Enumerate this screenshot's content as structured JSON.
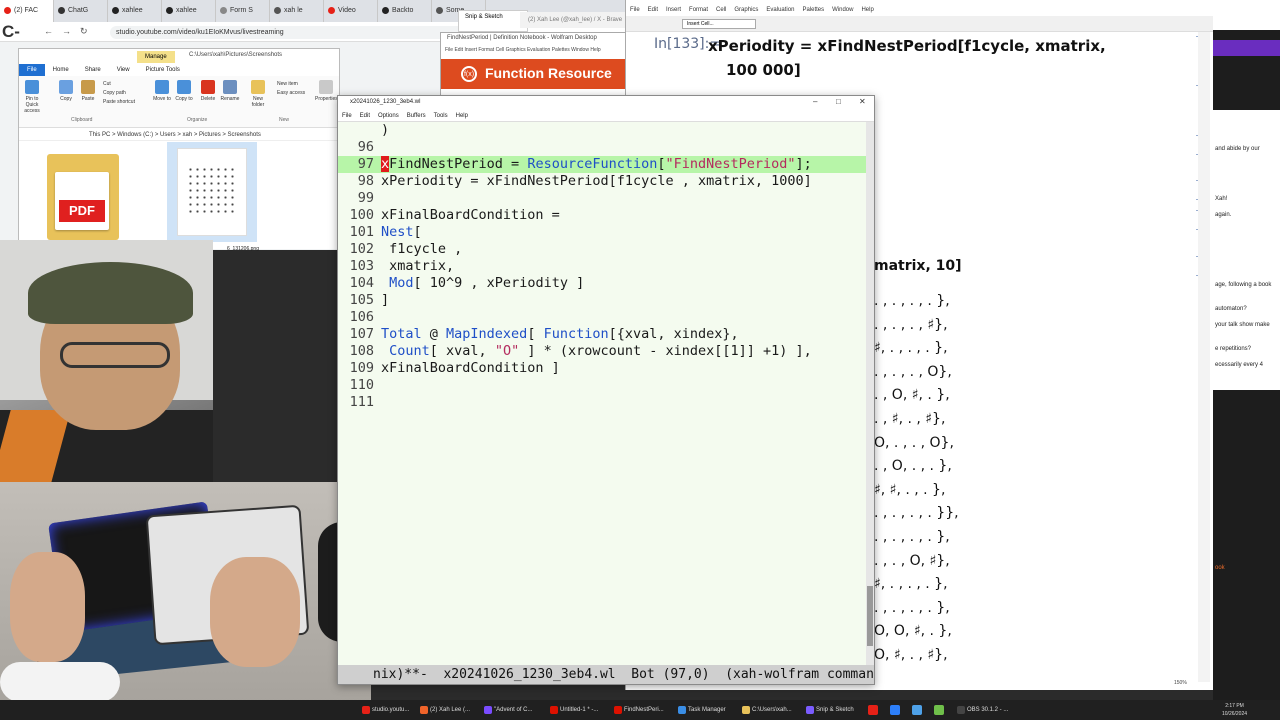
{
  "browser": {
    "tabs": [
      {
        "label": "(2) FAC",
        "color": "#e62117"
      },
      {
        "label": "ChatG",
        "color": "#333333"
      },
      {
        "label": "xahlee",
        "color": "#222222"
      },
      {
        "label": "xahlee",
        "color": "#222222"
      },
      {
        "label": "Form S",
        "color": "#888888"
      },
      {
        "label": "xah le",
        "color": "#555555"
      },
      {
        "label": "Video",
        "color": "#e62117"
      },
      {
        "label": "Backto",
        "color": "#222222"
      },
      {
        "label": "Some",
        "color": "#555555"
      }
    ],
    "url": "studio.youtube.com/video/ku1EIoKMvus/livestreaming",
    "app_label": "C-"
  },
  "explorer": {
    "manage": "Manage",
    "path": "C:\\Users\\xah\\Pictures\\Screenshots",
    "ribbon_tabs": [
      "File",
      "Home",
      "Share",
      "View",
      "Picture Tools"
    ],
    "buttons": [
      "Pin to Quick access",
      "Copy",
      "Paste",
      "Move to",
      "Copy to",
      "Delete",
      "Rename",
      "New folder",
      "Properties"
    ],
    "small_buttons": [
      "Cut",
      "Copy path",
      "Paste shortcut",
      "New item",
      "Easy access",
      "Open",
      "Edit",
      "Select all"
    ],
    "groups": [
      "Clipboard",
      "Organize",
      "New"
    ],
    "address": "This PC  >  Windows (C:)  >  Users  >  xah  >  Pictures  >  Screenshots",
    "pdf_label": "PDF",
    "thumb_caption": "6_131206.png"
  },
  "function_resource": {
    "title": "FindNestPeriod | Definition Notebook - Wolfram Desktop",
    "menu": "File  Edit  Insert  Format  Cell  Graphics  Evaluation  Palettes  Window  Help",
    "banner": "Function Resource"
  },
  "snip": {
    "label": "Snip & Sketch"
  },
  "xtab": {
    "label": "(2) Xah Lee (@xah_lee) / X - Brave"
  },
  "wolfram": {
    "menu": [
      "File",
      "Edit",
      "Insert",
      "Format",
      "Cell",
      "Graphics",
      "Evaluation",
      "Palettes",
      "Window",
      "Help"
    ],
    "cell_style": "Insert Cell...",
    "in_label": "In[133]:=",
    "input_line1": "xPeriodity = xFindNestPeriod[f1cycle, xmatrix,",
    "input_line2": "100 000]",
    "output_tail": "matrix, 10]",
    "grid_rows": [
      ". , . , . , . },",
      ". , . , . , ♯},",
      "♯, . , . , . },",
      ". , . , . , O},",
      ". , O, ♯, . },",
      ". , ♯, . , ♯},",
      "O, . , . , O},",
      ". , O, . , . },",
      "♯, ♯, . , . },",
      ". , . , . , . }},",
      ". , . , . , . },",
      ". , . , O, ♯},",
      "♯, . , . , . },",
      ". , . , . , . },",
      "O, O, ♯, . },",
      "O, ♯, . , ♯},"
    ],
    "zoom": "150%"
  },
  "chat": {
    "lines_white": [
      "and abide by our",
      "Xah!",
      "again.",
      "age, following a book",
      "automaton?",
      "your talk show make",
      "e repetitions?",
      "ecessarily every 4"
    ],
    "book": "ook"
  },
  "emacs": {
    "title": "x20241026_1230_3eb4.wl",
    "menu": [
      "File",
      "Edit",
      "Options",
      "Buffers",
      "Tools",
      "Help"
    ],
    "lines": [
      {
        "n": "",
        "code": ")"
      },
      {
        "n": "96",
        "code": ""
      },
      {
        "n": "97",
        "code": "xFindNestPeriod = ResourceFunction[\"FindNestPeriod\"];"
      },
      {
        "n": "98",
        "code": "xPeriodity = xFindNestPeriod[f1cycle , xmatrix, 1000]"
      },
      {
        "n": "99",
        "code": ""
      },
      {
        "n": "100",
        "code": "xFinalBoardCondition ="
      },
      {
        "n": "101",
        "code": "Nest["
      },
      {
        "n": "102",
        "code": " f1cycle ,"
      },
      {
        "n": "103",
        "code": " xmatrix,"
      },
      {
        "n": "104",
        "code": " Mod[ 10^9 , xPeriodity ]"
      },
      {
        "n": "105",
        "code": "]"
      },
      {
        "n": "106",
        "code": ""
      },
      {
        "n": "107",
        "code": "Total @ MapIndexed[ Function[{xval, xindex},"
      },
      {
        "n": "108",
        "code": " Count[ xval, \"O\" ] * (xrowcount - xindex[[1]] +1) ],"
      },
      {
        "n": "109",
        "code": "xFinalBoardCondition ]"
      },
      {
        "n": "110",
        "code": ""
      },
      {
        "n": "111",
        "code": ""
      }
    ],
    "modeline": "nix)**-  x20241026_1230_3eb4.wl  Bot (97,0)  (xah-wolfram command-"
  },
  "taskbar": {
    "items": [
      {
        "label": "studio.youtu...",
        "color": "#e62117"
      },
      {
        "label": "(2) Xah Lee (...",
        "color": "#f0642a"
      },
      {
        "label": "\"Advent of C...",
        "color": "#7a4cff"
      },
      {
        "label": "Untitled-1 * -...",
        "color": "#dd1100"
      },
      {
        "label": "FindNestPeri...",
        "color": "#dd1100"
      },
      {
        "label": "Task Manager",
        "color": "#3a8ee6"
      },
      {
        "label": "C:\\Users\\xah...",
        "color": "#e8c25a"
      },
      {
        "label": "Snip & Sketch",
        "color": "#7b5cff"
      },
      {
        "label": "OBS 30.1.2 - ...",
        "color": "#444444"
      }
    ],
    "time": "2:17 PM",
    "date": "10/26/2024"
  }
}
